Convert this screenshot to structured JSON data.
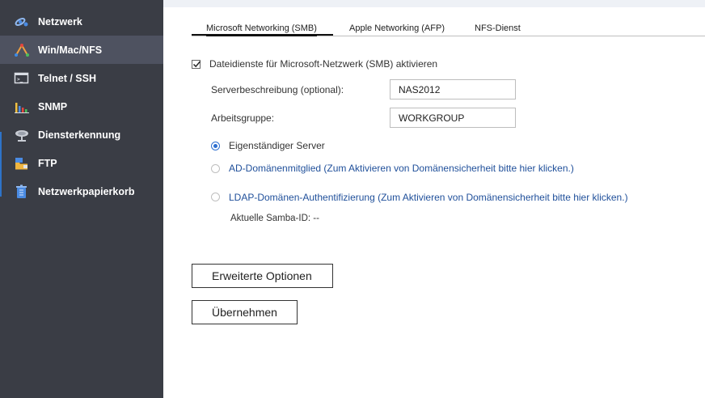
{
  "sidebar": {
    "items": [
      {
        "label": "Netzwerk",
        "icon": "network-icon"
      },
      {
        "label": "Win/Mac/NFS",
        "icon": "win-mac-nfs-icon"
      },
      {
        "label": "Telnet / SSH",
        "icon": "terminal-icon"
      },
      {
        "label": "SNMP",
        "icon": "chart-bars-icon"
      },
      {
        "label": "Diensterkennung",
        "icon": "satellite-dish-icon"
      },
      {
        "label": "FTP",
        "icon": "ftp-folder-icon"
      },
      {
        "label": "Netzwerkpapierkorb",
        "icon": "recycle-bin-icon"
      }
    ],
    "active_index": 1
  },
  "tabs": [
    {
      "label": "Microsoft Networking (SMB)"
    },
    {
      "label": "Apple Networking (AFP)"
    },
    {
      "label": "NFS-Dienst"
    }
  ],
  "smb": {
    "enable_label": "Dateidienste für Microsoft-Netzwerk (SMB) aktivieren",
    "enable_checked": true,
    "server_desc_label": "Serverbeschreibung (optional):",
    "server_desc_value": "NAS2012",
    "workgroup_label": "Arbeitsgruppe:",
    "workgroup_value": "WORKGROUP",
    "radio_standalone": "Eigenständiger Server",
    "radio_ad": "AD-Domänenmitglied (Zum Aktivieren von Domänensicherheit bitte hier klicken.)",
    "radio_ldap": "LDAP-Domänen-Authentifizierung (Zum Aktivieren von Domänensicherheit bitte hier klicken.)",
    "samba_id": "Aktuelle Samba-ID: --",
    "advanced_button": "Erweiterte Optionen",
    "apply_button": "Übernehmen"
  },
  "colors": {
    "sidebar_bg": "#3a3d45",
    "sidebar_active": "#4e5260",
    "accent_blue": "#2e6fd0",
    "link_blue": "#1f4f9a"
  }
}
